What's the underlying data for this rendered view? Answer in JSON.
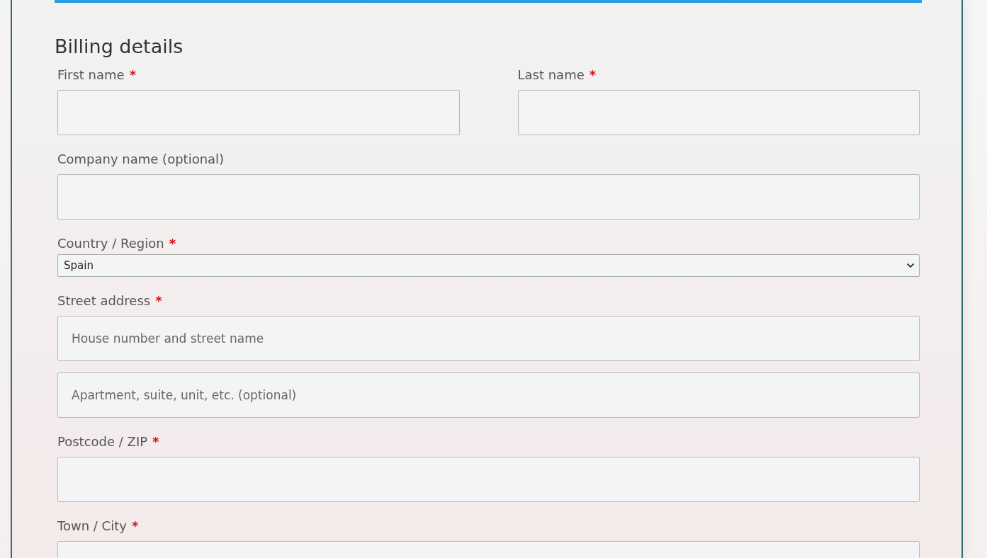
{
  "form": {
    "title": "Billing details",
    "rows": [
      [
        {
          "kind": "text",
          "label": "First name",
          "required_mark": "*"
        },
        {
          "kind": "text",
          "label": "Last name",
          "required_mark": "*"
        }
      ],
      [
        {
          "kind": "text",
          "label": "Company name (optional)"
        }
      ],
      [
        {
          "kind": "select",
          "label": "Country / Region",
          "required_mark": "*",
          "value": "Spain"
        }
      ],
      [
        {
          "kind": "multi",
          "label": "Street address",
          "required_mark": "*",
          "inputs": [
            {
              "placeholder": "House number and street name"
            },
            {
              "placeholder": "Apartment, suite, unit, etc. (optional)"
            }
          ]
        }
      ],
      [
        {
          "kind": "text",
          "label": "Postcode / ZIP",
          "required_mark": "*"
        }
      ],
      [
        {
          "kind": "text",
          "label": "Town / City",
          "required_mark": "*"
        }
      ]
    ]
  }
}
